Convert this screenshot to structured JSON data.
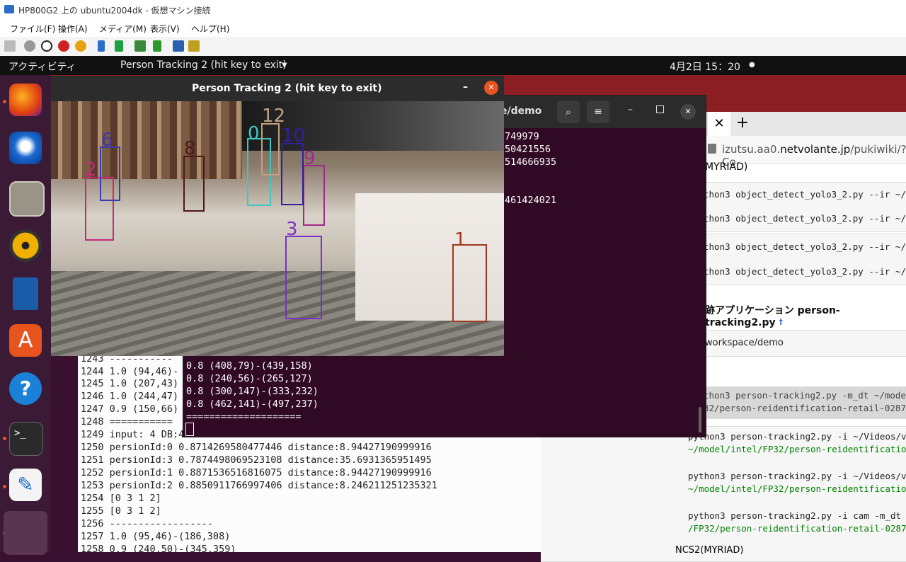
{
  "vm": {
    "title": "HP800G2 上の ubuntu2004dk - 仮想マシン接続",
    "menu": [
      "ファイル(F)",
      "操作(A)",
      "メディア(M)",
      "表示(V)",
      "ヘルプ(H)"
    ]
  },
  "ubuntu": {
    "activities": "アクティビティ",
    "app_menu": "Person Tracking 2  (hit key to exit)",
    "clock": "4月2日  15：20"
  },
  "video_window": {
    "title": "Person Tracking 2  (hit key to exit)",
    "boxes": [
      {
        "label": "0",
        "color": "#3cc8c0"
      },
      {
        "label": "1",
        "color": "#a03820"
      },
      {
        "label": "2",
        "color": "#c8287a"
      },
      {
        "label": "3",
        "color": "#7a30c8"
      },
      {
        "label": "6",
        "color": "#3a3ab0"
      },
      {
        "label": "8",
        "color": "#501818"
      },
      {
        "label": "9",
        "color": "#a02a8a"
      },
      {
        "label": "10",
        "color": "#3020a0"
      },
      {
        "label": "12",
        "color": "#c0a080"
      }
    ]
  },
  "terminal2": {
    "title": "e/demo",
    "top_lines": [
      "749979",
      "50421556",
      "514666935",
      "",
      "",
      "461424021"
    ],
    "bottom_lines": [
      "0.8 (408,79)-(439,158)",
      "0.8 (240,56)-(265,127)",
      "0.8 (300,147)-(333,232)",
      "0.8 (462,141)-(497,237)",
      "===================="
    ]
  },
  "terminal1": {
    "lines": [
      "1243 -----------",
      "1244 1.0 (94,46)-",
      "1245 1.0 (207,43)",
      "1246 1.0 (244,47)",
      "1247 0.9 (150,66)",
      "1248 ===========",
      "1249 input: 4 DB:4",
      "1250 persionId:0 0.8714269580477446 distance:8.94427190999916",
      "1251 persionId:3 0.7874498069523108 distance:35.6931365951495",
      "1252 persionId:1 0.8871536516816075 distance:8.94427190999916",
      "1253 persionId:2 0.8850911766997406 distance:8.246211251235321",
      "1254 [0 3 1 2]",
      "1255 [0 3 1 2]",
      "1256 ------------------",
      "1257 1.0 (95,46)-(186,308)",
      "1258 0.9 (240,50)-(345,359)"
    ]
  },
  "browser": {
    "url_prefix": "izutsu.aa0.",
    "url_domain": "netvolante.jp",
    "url_suffix": "/pukiwiki/?Co",
    "myriad": "MYRIAD)",
    "yolo_lines": [
      "thon3 object_detect_yolo3_2.py --ir ~/mod",
      "thon3 object_detect_yolo3_2.py --ir ~/mod",
      "thon3 object_detect_yolo3_2.py --ir ~/mod",
      "thon3 object_detect_yolo3_2.py --ir ~/mod"
    ],
    "heading": "跡アプリケーション person-tracking2.py",
    "heading_mark": "†",
    "workspace": "workspace/demo",
    "cmd1": [
      "thon3 person-tracking2.py -m_dt ~/model/i",
      "32/person-reidentification-retail-0287.x"
    ],
    "cmd2": [
      "python3 person-tracking2.py -i ~/Videos/vid",
      "~/model/intel/FP32/person-reidentification-"
    ],
    "cmd3": [
      "python3 person-tracking2.py -i ~/Videos/vid",
      "~/model/intel/FP32/person-reidentification-"
    ],
    "cmd4": [
      "python3 person-tracking2.py -i cam -m_dt ~/",
      "/FP32/person-reidentification-retail-0287.x"
    ],
    "bottom": "NCS2(MYRIAD)"
  }
}
